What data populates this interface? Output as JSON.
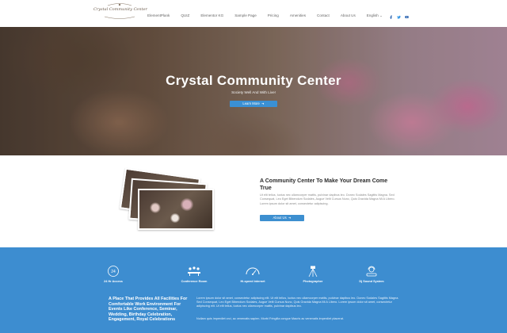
{
  "header": {
    "logo_text": "Crystal Community Center",
    "nav": [
      "ElementPlank",
      "QUIZ",
      "Elementor KG",
      "Sample Page",
      "Pricing",
      "Amenities",
      "Contact",
      "About Us",
      "English"
    ],
    "social_icons": [
      "facebook-icon",
      "twitter-icon",
      "youtube-icon"
    ]
  },
  "hero": {
    "title": "Crystal Community Center",
    "subtitle": "Society Well And With Live!",
    "button": "Learn More"
  },
  "about": {
    "title": "A Community Center To Make Your Dream Come True",
    "body": "Ut elit tellus, luctus nec ullamcorper mattis, pulvinar dapibus leo. Donec Sodales Sagittis Magna. Sed Consequat, Leo Eget Bibendum Sodales, Augue Velit Cursus Nunc, Quis Gravida Magna Mi A Libero. Lorem ipsum dolor sit amet, consectetur adipiscing.",
    "button": "About Us"
  },
  "features": [
    {
      "label": "24 Hr Access",
      "icon": "24-hour-icon"
    },
    {
      "label": "Conference Room",
      "icon": "conference-icon"
    },
    {
      "label": "Hi-speed internet",
      "icon": "speedometer-icon"
    },
    {
      "label": "Photographer",
      "icon": "tripod-icon"
    },
    {
      "label": "Dj Sound System",
      "icon": "dj-icon"
    }
  ],
  "place": {
    "title": "A Place That Provides All Facilities For Comfortable Work Environment For Events Like Conference, Seminar, Wedding, Birthday Celebration, Engagement, Royal Celebrations",
    "body1": "Lorem ipsum dolor sit amet, consectetur adipiscing elit. Ut elit tellus, luctus nec ullamcorper mattis, pulvinar dapibus leo. Donec Sodales Sagittis Magna. Sed Consequat, Leo Eget Bibendum Sodales, Augue Velit Cursus Nunc, Quis Gravida Magna Mi A Libero. Lorem ipsum dolor sit amet, consectetur adipiscing elit. Ut elit tellus, luctus nec ullamcorper mattis, pulvinar dapibus leo.",
    "body2": "Nullam quis imperdiet orci, ac venenatis sapien. Morbi Fringilla congue Mauris ac venenatis imperdiet placerat."
  },
  "colors": {
    "accent": "#3d8fd0",
    "band": "#3d8dd0"
  }
}
